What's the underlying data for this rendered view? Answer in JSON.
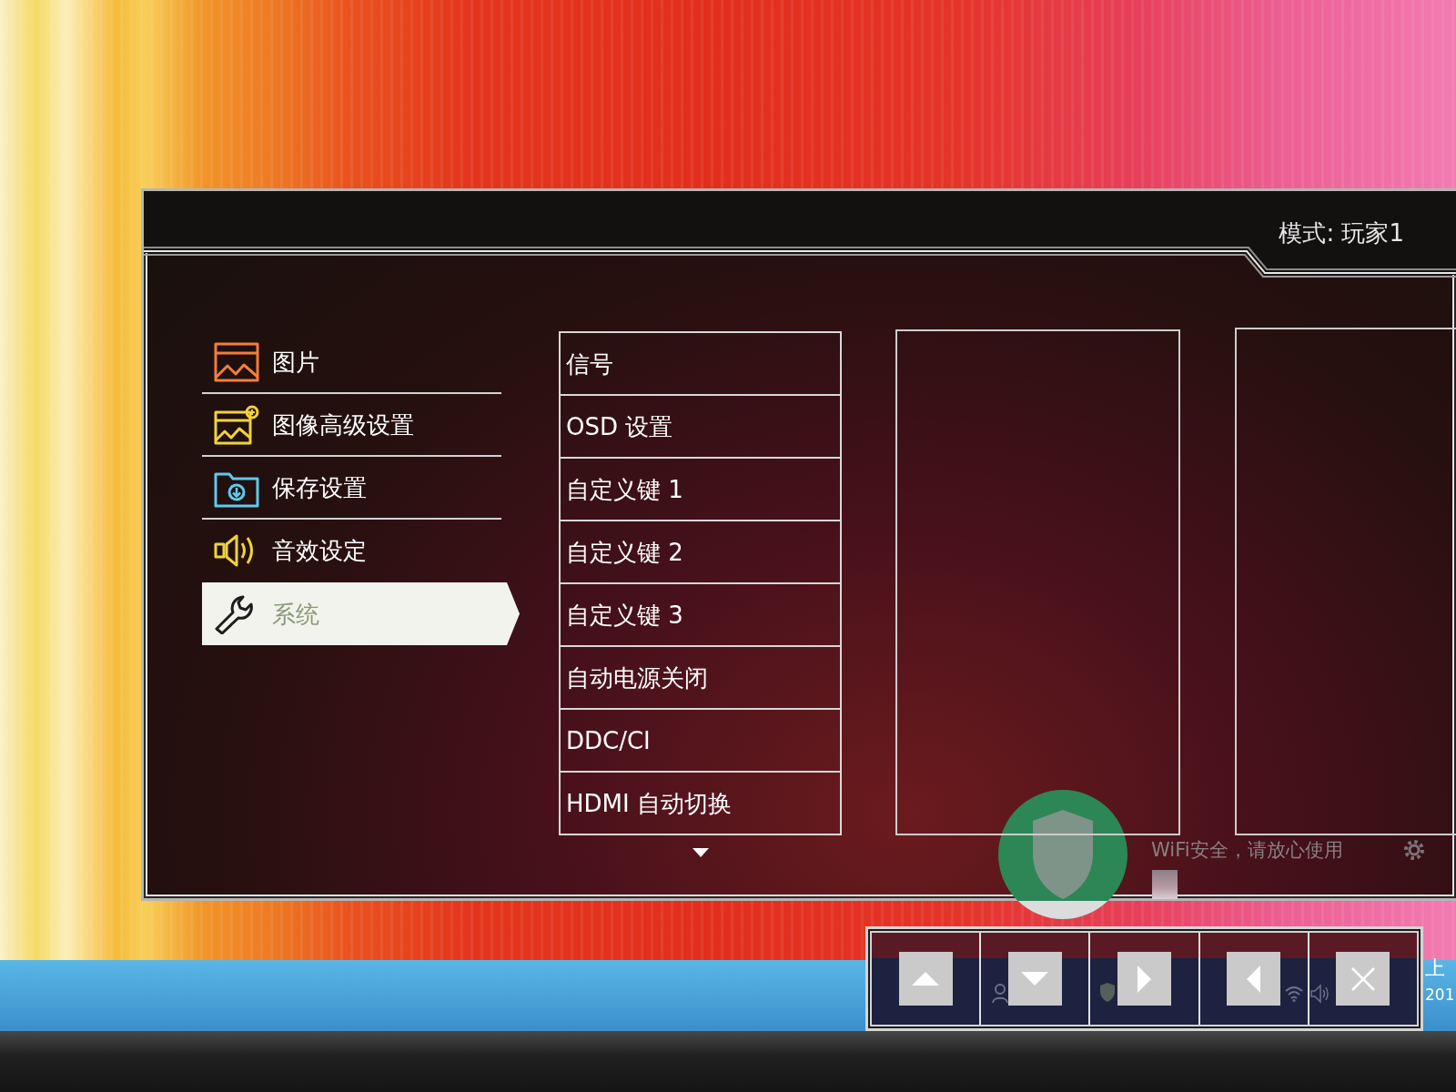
{
  "osd": {
    "mode_text": "模式: 玩家1",
    "main_menu": [
      {
        "kind": "picture",
        "label": "图片",
        "selected": false
      },
      {
        "kind": "picture_advanced",
        "label": "图像高级设置",
        "selected": false
      },
      {
        "kind": "save",
        "label": "保存设置",
        "selected": false
      },
      {
        "kind": "audio",
        "label": "音效设定",
        "selected": false
      },
      {
        "kind": "system",
        "label": "系统",
        "selected": true
      }
    ],
    "submenu": {
      "items": [
        {
          "label": "信号",
          "selected": false
        },
        {
          "label": "OSD 设置",
          "selected": false
        },
        {
          "label": "自定义键 1",
          "selected": false
        },
        {
          "label": "自定义键 2",
          "selected": false
        },
        {
          "label": "自定义键 3",
          "selected": false
        },
        {
          "label": "自动电源关闭",
          "selected": false
        },
        {
          "label": "DDC/CI",
          "selected": false
        },
        {
          "label": "HDMI 自动切换",
          "selected": false
        }
      ],
      "more_below": true
    }
  },
  "desktop": {
    "notification": {
      "text": "WiFi安全，请放心使用"
    },
    "clock_lines": [
      "上",
      "201"
    ]
  },
  "control_bar": {
    "buttons": [
      {
        "kind": "up"
      },
      {
        "kind": "down"
      },
      {
        "kind": "right"
      },
      {
        "kind": "left"
      },
      {
        "kind": "close"
      }
    ]
  }
}
